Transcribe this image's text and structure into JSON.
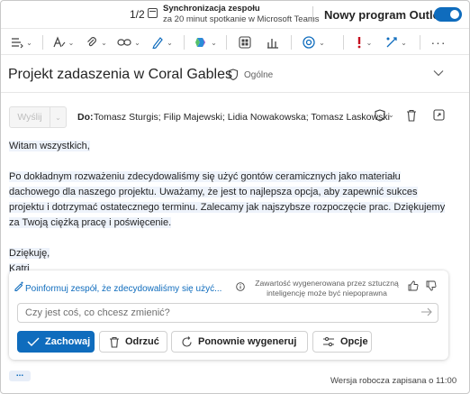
{
  "notification": {
    "counter": "1/2",
    "title": "Synchronizacja zespołu",
    "subtitle": "za 20 minut spotkanie w Microsoft Teams",
    "toggle_label": "Nowy program Outlook",
    "toggle_on": true
  },
  "ribbon": {
    "icons": [
      "paragraph-format-icon",
      "text-format-icon",
      "attach-icon",
      "link-icon",
      "draw-icon",
      "copilot-icon",
      "apps-icon",
      "insights-icon",
      "loop-icon",
      "importance-icon",
      "sensitivity-icon",
      "more-icon"
    ]
  },
  "subject": {
    "title": "Projekt zadaszenia w Coral Gables",
    "label": "Ogólne"
  },
  "compose": {
    "send_label": "Wyślij",
    "to_label": "Do:",
    "recipients": "Tomasz Sturgis; Filip Majewski; Lidia Nowakowska; Tomasz Laskowski"
  },
  "body": {
    "greeting": "Witam wszystkich,",
    "paragraph": [
      "Po dokładnym rozważeniu zdecydowaliśmy się użyć gontów ceramicznych jako materiału",
      "dachowego dla naszego projektu. Uważamy, że jest to najlepsza opcja, aby zapewnić sukces",
      "projektu i dotrzymać ostatecznego terminu. Zalecamy jak najszybsze rozpoczęcie prac. Dziękujemy",
      "za Twoją ciężką pracę i poświęcenie."
    ],
    "closing": "Dziękuję,",
    "signature": "Katri"
  },
  "copilot": {
    "prompt": "Poinformuj zespół, że zdecydowaliśmy się użyć...",
    "disclaimer": "Zawartość wygenerowana przez sztuczną inteligencję może być niepoprawna",
    "input_placeholder": "Czy jest coś, co chcesz zmienić?",
    "keep_label": "Zachowaj",
    "discard_label": "Odrzuć",
    "regenerate_label": "Ponownie wygeneruj",
    "options_label": "Opcje"
  },
  "footer": {
    "more": "...",
    "draft_status": "Wersja robocza zapisana o 11:00"
  },
  "colors": {
    "accent": "#0f6cbd",
    "highlight": "#eef3fb"
  }
}
